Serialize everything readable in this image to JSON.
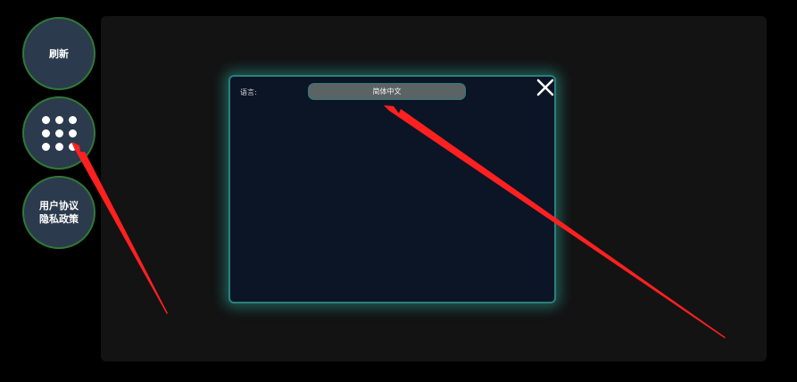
{
  "sidebar": {
    "refresh_label": "刷新",
    "menu_icon": "grid-dots-icon",
    "policy_line1": "用户协议",
    "policy_line2": "隐私政策"
  },
  "dialog": {
    "language_label": "语言:",
    "language_value": "简体中文",
    "close_icon": "close-icon"
  },
  "colors": {
    "background": "#000000",
    "side_button_fill": "#2b3a4d",
    "side_button_border": "#2f7a35",
    "panel": "#131313",
    "dialog_fill": "#0b1526",
    "dialog_border": "#2b7f7a",
    "select_fill": "#5c6364",
    "annotation_arrow": "#ff2020"
  }
}
